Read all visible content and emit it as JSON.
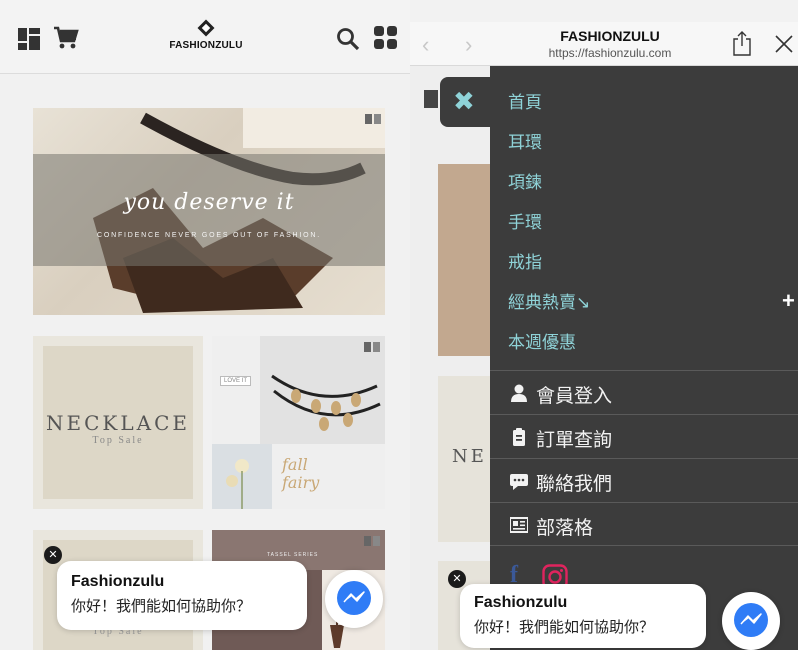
{
  "left": {
    "brand": "FASHIONZULU",
    "banner": {
      "script_text": "you deserve it",
      "tagline": "CONFIDENCE NEVER GOES OUT OF FASHION."
    },
    "card_necklace": {
      "title": "NECKLACE",
      "subtitle": "Top Sale"
    },
    "card_collage": {
      "tag": "LOVE IT",
      "script_line1": "fall",
      "script_line2": "fairy"
    },
    "card_bottom_left": {
      "subtitle": "Top Sale"
    },
    "card_bottom_right": {
      "label": "TASSEL SERIES"
    },
    "chat": {
      "name": "Fashionzulu",
      "message": "你好！我們能如何協助你？",
      "close": "✕"
    }
  },
  "right": {
    "browser": {
      "title": "FASHIONZULU",
      "url": "https://fashionzulu.com",
      "back": "‹",
      "forward": "›"
    },
    "behind_text": "NE",
    "close_menu": "✖",
    "menu": {
      "categories": [
        "首頁",
        "耳環",
        "項鍊",
        "手環",
        "戒指",
        "經典熱賣↘",
        "本週優惠"
      ],
      "expand": "+",
      "account": [
        {
          "label": "會員登入",
          "icon": "user-icon"
        },
        {
          "label": "訂單查詢",
          "icon": "clipboard-icon"
        },
        {
          "label": "聯絡我們",
          "icon": "chat-icon"
        },
        {
          "label": "部落格",
          "icon": "news-icon"
        }
      ],
      "social": {
        "facebook": "f",
        "instagram": "instagram-icon"
      }
    },
    "chat": {
      "name": "Fashionzulu",
      "message": "你好！我們能如何協助你？",
      "close": "✕"
    }
  },
  "colors": {
    "menu_bg": "#3c3c3c",
    "menu_accent": "#8fd3d8",
    "messenger_blue": "#2f7cf6"
  }
}
